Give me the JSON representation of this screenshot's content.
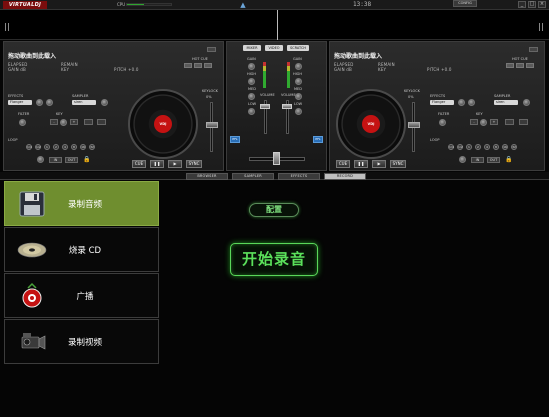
{
  "app": {
    "logo_text": "VIRTUALDJ",
    "cpu_label": "CPU",
    "cpu_load_fraction": 0.38,
    "clock": "13:38",
    "config_label": "CONFIG",
    "window_controls": [
      "_",
      "□",
      "×"
    ]
  },
  "deck_left": {
    "title": "拖动歌曲到此载入",
    "elapsed_label": "ELAPSED",
    "remain_label": "REMAIN",
    "gain_label": "GAIN dB",
    "key_label": "KEY",
    "pitch_label": "PITCH +0.0",
    "hot_cue_label": "HOT CUE",
    "effects_label": "EFFECTS",
    "effect_value": "Flanger",
    "sampler_label": "SAMPLER",
    "sampler_value": "siren",
    "filter_label": "FILTER",
    "key2_label": "KEY",
    "loop_label": "LOOP",
    "loop_values": [
      "1/4",
      "1/2",
      "1",
      "2",
      "4",
      "8",
      "16",
      "32"
    ],
    "in_label": "IN",
    "out_label": "OUT",
    "pitch_pct": "0%",
    "keylock_label": "KEYLOCK",
    "cue_label": "CUE",
    "play_label": "▶",
    "pause_label": "❚❚",
    "sync_label": "SYNC",
    "platter_label": "VDJ"
  },
  "deck_right": {
    "title": "拖动歌曲到此载入",
    "elapsed_label": "ELAPSED",
    "remain_label": "REMAIN",
    "gain_label": "GAIN dB",
    "key_label": "KEY",
    "pitch_label": "PITCH +0.0",
    "hot_cue_label": "HOT CUE",
    "effects_label": "EFFECTS",
    "effect_value": "Flanger",
    "sampler_label": "SAMPLER",
    "sampler_value": "siren",
    "filter_label": "FILTER",
    "key2_label": "KEY",
    "loop_label": "LOOP",
    "loop_values": [
      "1/4",
      "1/2",
      "1",
      "2",
      "4",
      "8",
      "16",
      "32"
    ],
    "in_label": "IN",
    "out_label": "OUT",
    "pitch_pct": "0%",
    "keylock_label": "KEYLOCK",
    "cue_label": "CUE",
    "play_label": "▶",
    "pause_label": "❚❚",
    "sync_label": "SYNC",
    "platter_label": "VDJ"
  },
  "mixer": {
    "tabs": [
      "MIXER",
      "VIDEO",
      "SCRATCH"
    ],
    "gain_label": "GAIN",
    "high_label": "HIGH",
    "med_label": "MED",
    "low_label": "LOW",
    "volume_label": "VOLUME",
    "pfl_left": "PFL",
    "pfl_right": "PFL"
  },
  "bottom_tabs": [
    {
      "label": "BROWSER",
      "active": false
    },
    {
      "label": "SAMPLER",
      "active": false
    },
    {
      "label": "EFFECTS",
      "active": false
    },
    {
      "label": "RECORD",
      "active": true
    }
  ],
  "record": {
    "items": [
      {
        "label": "录制音频",
        "icon": "floppy-disk-icon",
        "active": true
      },
      {
        "label": "烧录 CD",
        "icon": "cd-disc-icon",
        "active": false
      },
      {
        "label": "广播",
        "icon": "broadcast-icon",
        "active": false
      },
      {
        "label": "录制视频",
        "icon": "video-camera-icon",
        "active": false
      }
    ],
    "config_button": "配置",
    "start_button": "开始录音"
  },
  "colors": {
    "accent_green": "#5be05b",
    "active_item": "#6f8e2f",
    "platter_red": "#c51212",
    "logo_red": "#7a0d0d"
  }
}
